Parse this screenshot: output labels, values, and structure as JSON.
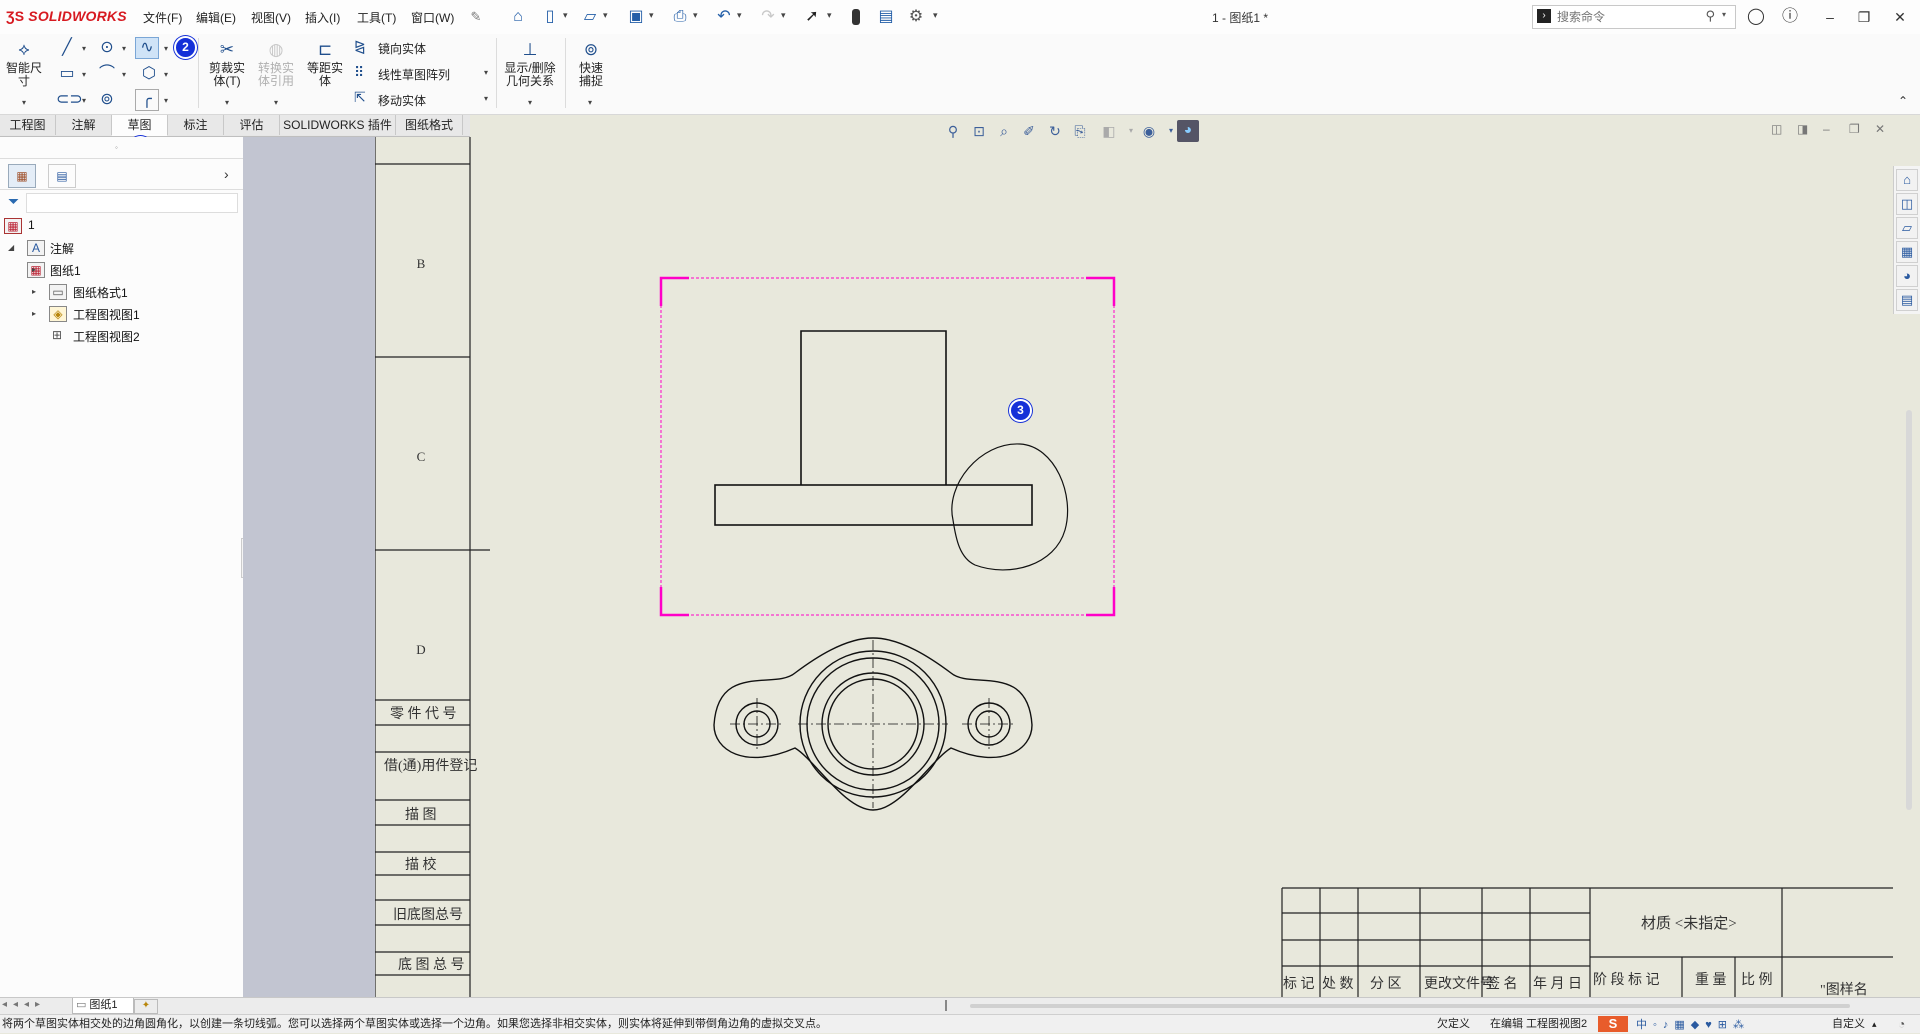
{
  "app": {
    "brand": "SOLIDWORKS",
    "document_title": "1 - 图纸1 *",
    "menus": [
      "文件(F)",
      "编辑(E)",
      "视图(V)",
      "插入(I)",
      "工具(T)",
      "窗口(W)"
    ],
    "search_placeholder": "搜索命令"
  },
  "commands": {
    "smart_dimension": "智能尺寸",
    "trim": "剪裁实体(T)",
    "convert": "转换实体引用",
    "offset": "等距实体",
    "mirror": "镜向实体",
    "linear_pattern": "线性草图阵列",
    "move": "移动实体",
    "relations": "显示/删除几何关系",
    "quick_snaps": "快速捕捉"
  },
  "tabs": [
    {
      "label": "工程图",
      "active": false
    },
    {
      "label": "注解",
      "active": false
    },
    {
      "label": "草图",
      "active": true
    },
    {
      "label": "标注",
      "active": false
    },
    {
      "label": "评估",
      "active": false
    },
    {
      "label": "SOLIDWORKS 插件",
      "active": false
    },
    {
      "label": "图纸格式",
      "active": false
    }
  ],
  "tree": {
    "root": "1",
    "annotations": "注解",
    "sheet": "图纸1",
    "sheet_format": "图纸格式1",
    "view1": "工程图视图1",
    "view2": "工程图视图2"
  },
  "markers": [
    "1",
    "2",
    "3"
  ],
  "drawing": {
    "zone_labels": [
      "B",
      "C",
      "D"
    ],
    "side_block": [
      "零 件 代 号",
      "借(通)用件登记",
      "描 图",
      "描 校",
      "旧底图总号",
      "底 图 总 号"
    ],
    "title_block": {
      "material": "材质 <未指定>",
      "stage_mark": "阶 段 标 记",
      "weight": "重 量",
      "scale": "比 例",
      "bottom_headers": [
        "标 记",
        "处 数",
        "分 区",
        "更改文件号",
        "签 名",
        "年 月 日"
      ],
      "drawing_name": "\"图样名"
    }
  },
  "sheet_tab": "图纸1",
  "status": {
    "message": "将两个草图实体相交处的边角圆角化，以创建一条切线弧。您可以选择两个草图实体或选择一个边角。如果您选择非相交实体，则实体将延伸到带倒角边角的虚拟交叉点。",
    "definition": "欠定义",
    "editing": "在编辑 工程图视图2",
    "custom": "自定义"
  },
  "colors": {
    "accent": "#1530d8",
    "selection": "#ff00c8",
    "brand": "#d71920"
  }
}
